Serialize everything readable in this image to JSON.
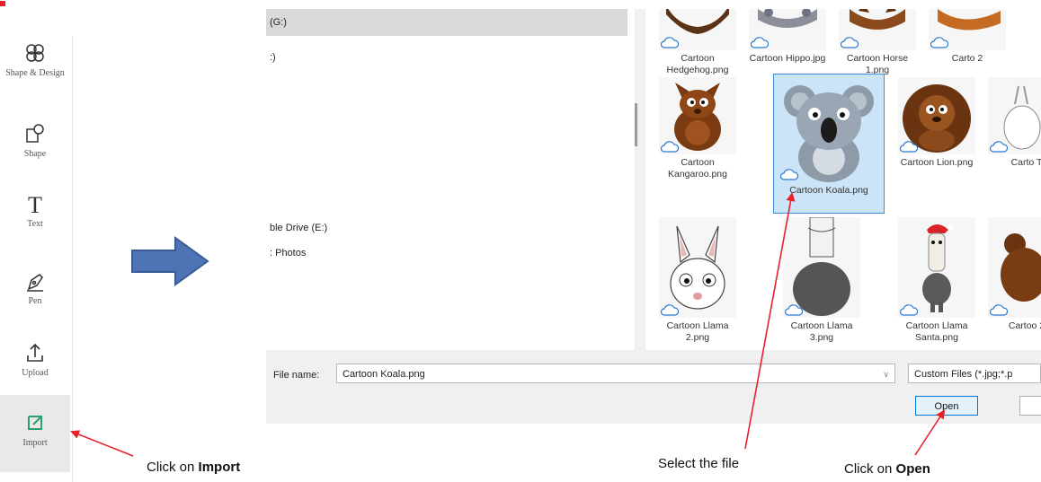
{
  "toolbar": {
    "items": [
      {
        "label": "Shape & Design",
        "icon": "shape-design-icon"
      },
      {
        "label": "Shape",
        "icon": "shape-icon"
      },
      {
        "label": "Text",
        "icon": "text-icon"
      },
      {
        "label": "Pen",
        "icon": "pen-icon"
      },
      {
        "label": "Upload",
        "icon": "upload-icon"
      },
      {
        "label": "Import",
        "icon": "import-icon"
      }
    ]
  },
  "dialog": {
    "nav": [
      {
        "label": "(G:)"
      },
      {
        "label": ":)"
      },
      {
        "label": "ble Drive (E:)"
      },
      {
        "label": ": Photos"
      }
    ],
    "files": [
      {
        "name": "Cartoon Hedgehog.png"
      },
      {
        "name": "Cartoon Hippo.jpg"
      },
      {
        "name": "Cartoon Horse 1.png"
      },
      {
        "name": "Carto 2"
      },
      {
        "name": "Cartoon Kangaroo.png"
      },
      {
        "name": "Cartoon Koala.png"
      },
      {
        "name": "Cartoon Lion.png"
      },
      {
        "name": "Carto T"
      },
      {
        "name": "Cartoon Llama 2.png"
      },
      {
        "name": "Cartoon Llama 3.png"
      },
      {
        "name": "Cartoon Llama Santa.png"
      },
      {
        "name": "Cartoo 2"
      }
    ],
    "filename_label": "File name:",
    "filename_value": "Cartoon Koala.png",
    "filter_value": "Custom Files (*.jpg;*.p",
    "open_label": "Open"
  },
  "annotations": {
    "import_prefix": "Click on ",
    "import_bold": "Import",
    "select": "Select the file",
    "open_prefix": "Click on ",
    "open_bold": "Open"
  },
  "colors": {
    "arrow_fill": "#4f74b5",
    "arrow_stroke": "#3a5a94",
    "annotation_red": "#e8202a",
    "selection_blue": "#cce4f7"
  }
}
